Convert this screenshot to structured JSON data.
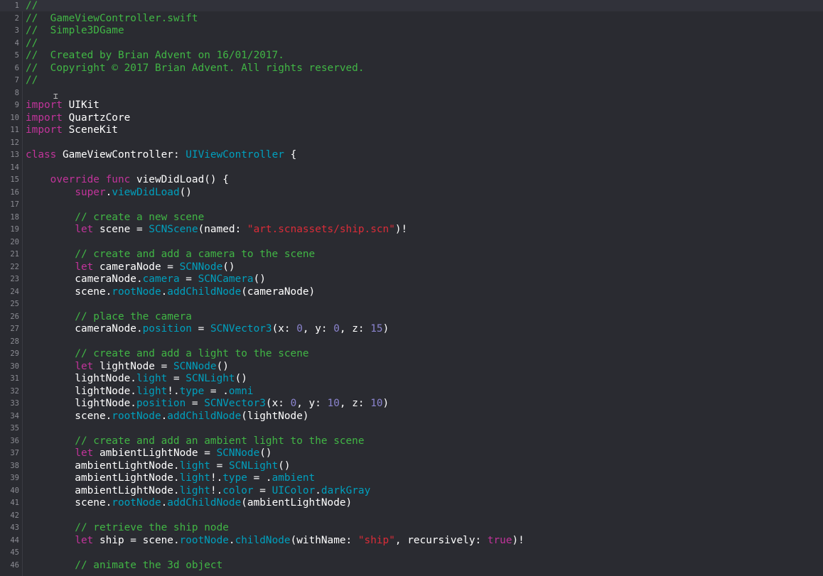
{
  "editor": {
    "file": "GameViewController.swift",
    "colors": {
      "background": "#2a2b31",
      "comment": "#41b645",
      "keyword": "#c2349b",
      "type": "#00a0be",
      "string": "#db2c38",
      "number": "#8b84cf",
      "plain": "#ffffff",
      "line_number": "#8b8c93"
    },
    "lines": [
      {
        "n": "1",
        "tokens": [
          {
            "t": "//",
            "c": "comment"
          }
        ]
      },
      {
        "n": "2",
        "tokens": [
          {
            "t": "//  GameViewController.swift",
            "c": "comment"
          }
        ]
      },
      {
        "n": "3",
        "tokens": [
          {
            "t": "//  Simple3DGame",
            "c": "comment"
          }
        ]
      },
      {
        "n": "4",
        "tokens": [
          {
            "t": "//",
            "c": "comment"
          }
        ]
      },
      {
        "n": "5",
        "tokens": [
          {
            "t": "//  Created by Brian Advent on 16/01/2017.",
            "c": "comment"
          }
        ]
      },
      {
        "n": "6",
        "tokens": [
          {
            "t": "//  Copyright © 2017 Brian Advent. All rights reserved.",
            "c": "comment"
          }
        ]
      },
      {
        "n": "7",
        "tokens": [
          {
            "t": "//",
            "c": "comment"
          }
        ]
      },
      {
        "n": "8",
        "tokens": []
      },
      {
        "n": "9",
        "tokens": [
          {
            "t": "import",
            "c": "keyword"
          },
          {
            "t": " UIKit",
            "c": "plain"
          }
        ]
      },
      {
        "n": "10",
        "tokens": [
          {
            "t": "import",
            "c": "keyword"
          },
          {
            "t": " QuartzCore",
            "c": "plain"
          }
        ]
      },
      {
        "n": "11",
        "tokens": [
          {
            "t": "import",
            "c": "keyword"
          },
          {
            "t": " SceneKit",
            "c": "plain"
          }
        ]
      },
      {
        "n": "12",
        "tokens": []
      },
      {
        "n": "13",
        "tokens": [
          {
            "t": "class",
            "c": "keyword"
          },
          {
            "t": " GameViewController: ",
            "c": "plain"
          },
          {
            "t": "UIViewController",
            "c": "type"
          },
          {
            "t": " {",
            "c": "plain"
          }
        ]
      },
      {
        "n": "14",
        "tokens": []
      },
      {
        "n": "15",
        "tokens": [
          {
            "t": "    ",
            "c": "plain"
          },
          {
            "t": "override",
            "c": "keyword"
          },
          {
            "t": " ",
            "c": "plain"
          },
          {
            "t": "func",
            "c": "keyword"
          },
          {
            "t": " viewDidLoad() {",
            "c": "plain"
          }
        ]
      },
      {
        "n": "16",
        "tokens": [
          {
            "t": "        ",
            "c": "plain"
          },
          {
            "t": "super",
            "c": "keyword"
          },
          {
            "t": ".",
            "c": "plain"
          },
          {
            "t": "viewDidLoad",
            "c": "member"
          },
          {
            "t": "()",
            "c": "plain"
          }
        ]
      },
      {
        "n": "17",
        "tokens": []
      },
      {
        "n": "18",
        "tokens": [
          {
            "t": "        // create a new scene",
            "c": "comment"
          }
        ]
      },
      {
        "n": "19",
        "tokens": [
          {
            "t": "        ",
            "c": "plain"
          },
          {
            "t": "let",
            "c": "keyword"
          },
          {
            "t": " scene = ",
            "c": "plain"
          },
          {
            "t": "SCNScene",
            "c": "type"
          },
          {
            "t": "(named: ",
            "c": "plain"
          },
          {
            "t": "\"art.scnassets/ship.scn\"",
            "c": "string"
          },
          {
            "t": ")!",
            "c": "plain"
          }
        ]
      },
      {
        "n": "20",
        "tokens": []
      },
      {
        "n": "21",
        "tokens": [
          {
            "t": "        // create and add a camera to the scene",
            "c": "comment"
          }
        ]
      },
      {
        "n": "22",
        "tokens": [
          {
            "t": "        ",
            "c": "plain"
          },
          {
            "t": "let",
            "c": "keyword"
          },
          {
            "t": " cameraNode = ",
            "c": "plain"
          },
          {
            "t": "SCNNode",
            "c": "type"
          },
          {
            "t": "()",
            "c": "plain"
          }
        ]
      },
      {
        "n": "23",
        "tokens": [
          {
            "t": "        cameraNode.",
            "c": "plain"
          },
          {
            "t": "camera",
            "c": "member"
          },
          {
            "t": " = ",
            "c": "plain"
          },
          {
            "t": "SCNCamera",
            "c": "type"
          },
          {
            "t": "()",
            "c": "plain"
          }
        ]
      },
      {
        "n": "24",
        "tokens": [
          {
            "t": "        scene.",
            "c": "plain"
          },
          {
            "t": "rootNode",
            "c": "member"
          },
          {
            "t": ".",
            "c": "plain"
          },
          {
            "t": "addChildNode",
            "c": "member"
          },
          {
            "t": "(cameraNode)",
            "c": "plain"
          }
        ]
      },
      {
        "n": "25",
        "tokens": []
      },
      {
        "n": "26",
        "tokens": [
          {
            "t": "        // place the camera",
            "c": "comment"
          }
        ]
      },
      {
        "n": "27",
        "tokens": [
          {
            "t": "        cameraNode.",
            "c": "plain"
          },
          {
            "t": "position",
            "c": "member"
          },
          {
            "t": " = ",
            "c": "plain"
          },
          {
            "t": "SCNVector3",
            "c": "type"
          },
          {
            "t": "(x: ",
            "c": "plain"
          },
          {
            "t": "0",
            "c": "number"
          },
          {
            "t": ", y: ",
            "c": "plain"
          },
          {
            "t": "0",
            "c": "number"
          },
          {
            "t": ", z: ",
            "c": "plain"
          },
          {
            "t": "15",
            "c": "number"
          },
          {
            "t": ")",
            "c": "plain"
          }
        ]
      },
      {
        "n": "28",
        "tokens": []
      },
      {
        "n": "29",
        "tokens": [
          {
            "t": "        // create and add a light to the scene",
            "c": "comment"
          }
        ]
      },
      {
        "n": "30",
        "tokens": [
          {
            "t": "        ",
            "c": "plain"
          },
          {
            "t": "let",
            "c": "keyword"
          },
          {
            "t": " lightNode = ",
            "c": "plain"
          },
          {
            "t": "SCNNode",
            "c": "type"
          },
          {
            "t": "()",
            "c": "plain"
          }
        ]
      },
      {
        "n": "31",
        "tokens": [
          {
            "t": "        lightNode.",
            "c": "plain"
          },
          {
            "t": "light",
            "c": "member"
          },
          {
            "t": " = ",
            "c": "plain"
          },
          {
            "t": "SCNLight",
            "c": "type"
          },
          {
            "t": "()",
            "c": "plain"
          }
        ]
      },
      {
        "n": "32",
        "tokens": [
          {
            "t": "        lightNode.",
            "c": "plain"
          },
          {
            "t": "light",
            "c": "member"
          },
          {
            "t": "!.",
            "c": "plain"
          },
          {
            "t": "type",
            "c": "member"
          },
          {
            "t": " = .",
            "c": "plain"
          },
          {
            "t": "omni",
            "c": "member"
          }
        ]
      },
      {
        "n": "33",
        "tokens": [
          {
            "t": "        lightNode.",
            "c": "plain"
          },
          {
            "t": "position",
            "c": "member"
          },
          {
            "t": " = ",
            "c": "plain"
          },
          {
            "t": "SCNVector3",
            "c": "type"
          },
          {
            "t": "(x: ",
            "c": "plain"
          },
          {
            "t": "0",
            "c": "number"
          },
          {
            "t": ", y: ",
            "c": "plain"
          },
          {
            "t": "10",
            "c": "number"
          },
          {
            "t": ", z: ",
            "c": "plain"
          },
          {
            "t": "10",
            "c": "number"
          },
          {
            "t": ")",
            "c": "plain"
          }
        ]
      },
      {
        "n": "34",
        "tokens": [
          {
            "t": "        scene.",
            "c": "plain"
          },
          {
            "t": "rootNode",
            "c": "member"
          },
          {
            "t": ".",
            "c": "plain"
          },
          {
            "t": "addChildNode",
            "c": "member"
          },
          {
            "t": "(lightNode)",
            "c": "plain"
          }
        ]
      },
      {
        "n": "35",
        "tokens": []
      },
      {
        "n": "36",
        "tokens": [
          {
            "t": "        // create and add an ambient light to the scene",
            "c": "comment"
          }
        ]
      },
      {
        "n": "37",
        "tokens": [
          {
            "t": "        ",
            "c": "plain"
          },
          {
            "t": "let",
            "c": "keyword"
          },
          {
            "t": " ambientLightNode = ",
            "c": "plain"
          },
          {
            "t": "SCNNode",
            "c": "type"
          },
          {
            "t": "()",
            "c": "plain"
          }
        ]
      },
      {
        "n": "38",
        "tokens": [
          {
            "t": "        ambientLightNode.",
            "c": "plain"
          },
          {
            "t": "light",
            "c": "member"
          },
          {
            "t": " = ",
            "c": "plain"
          },
          {
            "t": "SCNLight",
            "c": "type"
          },
          {
            "t": "()",
            "c": "plain"
          }
        ]
      },
      {
        "n": "39",
        "tokens": [
          {
            "t": "        ambientLightNode.",
            "c": "plain"
          },
          {
            "t": "light",
            "c": "member"
          },
          {
            "t": "!.",
            "c": "plain"
          },
          {
            "t": "type",
            "c": "member"
          },
          {
            "t": " = .",
            "c": "plain"
          },
          {
            "t": "ambient",
            "c": "member"
          }
        ]
      },
      {
        "n": "40",
        "tokens": [
          {
            "t": "        ambientLightNode.",
            "c": "plain"
          },
          {
            "t": "light",
            "c": "member"
          },
          {
            "t": "!.",
            "c": "plain"
          },
          {
            "t": "color",
            "c": "member"
          },
          {
            "t": " = ",
            "c": "plain"
          },
          {
            "t": "UIColor",
            "c": "type"
          },
          {
            "t": ".",
            "c": "plain"
          },
          {
            "t": "darkGray",
            "c": "member"
          }
        ]
      },
      {
        "n": "41",
        "tokens": [
          {
            "t": "        scene.",
            "c": "plain"
          },
          {
            "t": "rootNode",
            "c": "member"
          },
          {
            "t": ".",
            "c": "plain"
          },
          {
            "t": "addChildNode",
            "c": "member"
          },
          {
            "t": "(ambientLightNode)",
            "c": "plain"
          }
        ]
      },
      {
        "n": "42",
        "tokens": []
      },
      {
        "n": "43",
        "tokens": [
          {
            "t": "        // retrieve the ship node",
            "c": "comment"
          }
        ]
      },
      {
        "n": "44",
        "tokens": [
          {
            "t": "        ",
            "c": "plain"
          },
          {
            "t": "let",
            "c": "keyword"
          },
          {
            "t": " ship = scene.",
            "c": "plain"
          },
          {
            "t": "rootNode",
            "c": "member"
          },
          {
            "t": ".",
            "c": "plain"
          },
          {
            "t": "childNode",
            "c": "member"
          },
          {
            "t": "(withName: ",
            "c": "plain"
          },
          {
            "t": "\"ship\"",
            "c": "string"
          },
          {
            "t": ", recursively: ",
            "c": "plain"
          },
          {
            "t": "true",
            "c": "keyword"
          },
          {
            "t": ")!",
            "c": "plain"
          }
        ]
      },
      {
        "n": "45",
        "tokens": []
      },
      {
        "n": "46",
        "tokens": [
          {
            "t": "        // animate the 3d object",
            "c": "comment"
          }
        ]
      }
    ]
  }
}
